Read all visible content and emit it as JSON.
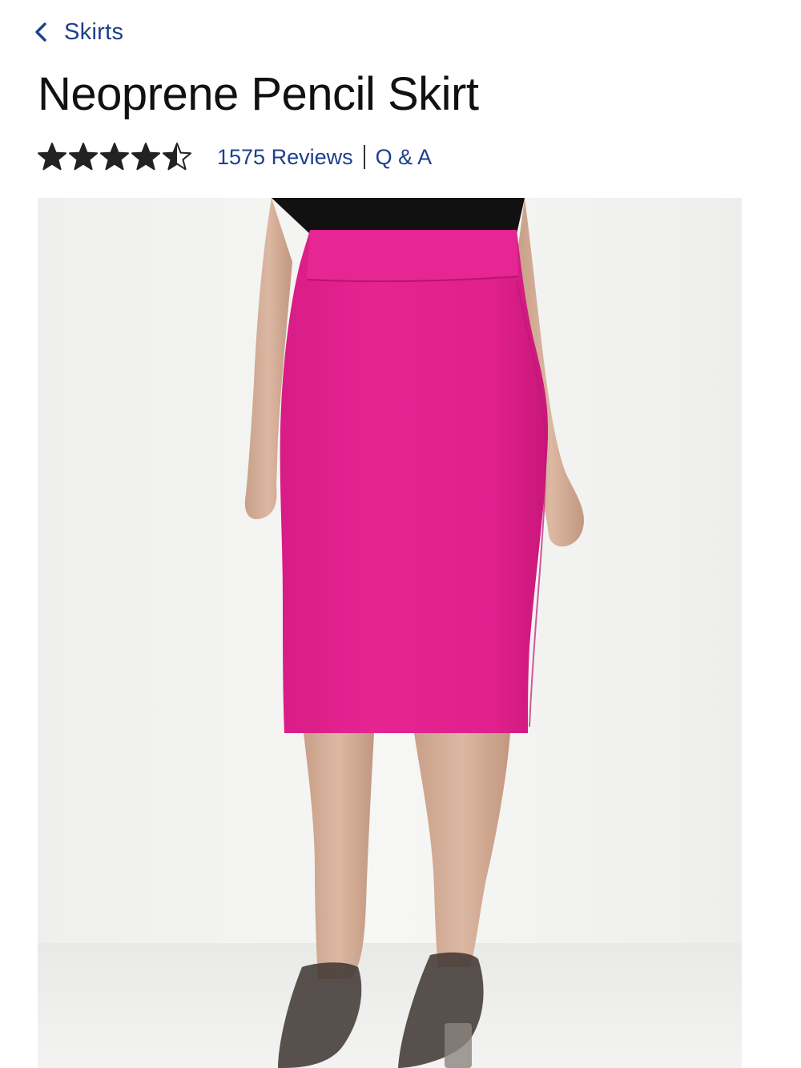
{
  "nav": {
    "back_label": "Skirts",
    "back_icon": "chevron-left-icon"
  },
  "product": {
    "title": "Neoprene Pencil Skirt",
    "rating": 4.5,
    "rating_max": 5,
    "reviews_label": "1575 Reviews",
    "qa_label": "Q & A",
    "image_icon": "product-photo"
  },
  "colors": {
    "link": "#1e3f8c",
    "text": "#111111",
    "star": "#222222",
    "separator": "#333333",
    "skirt": "#e3218e"
  }
}
